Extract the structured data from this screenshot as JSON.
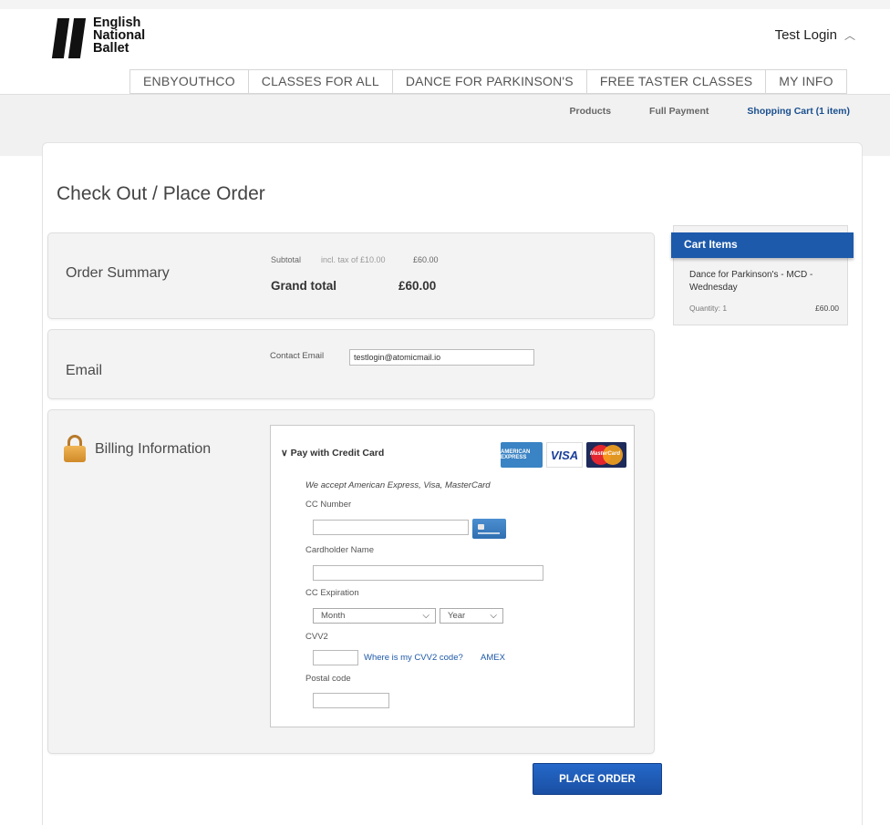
{
  "header": {
    "logo_line1": "English",
    "logo_line2": "National",
    "logo_line3": "Ballet",
    "login_label": "Test Login",
    "login_chevron": "︿"
  },
  "nav": {
    "items": [
      "ENBYOUTHCO",
      "CLASSES FOR ALL",
      "DANCE FOR PARKINSON'S",
      "FREE TASTER CLASSES",
      "MY INFO"
    ]
  },
  "subnav": {
    "products": "Products",
    "full_payment": "Full Payment",
    "shopping_cart": "Shopping Cart (1 item)"
  },
  "page_title": "Check Out / Place Order",
  "order_summary": {
    "title": "Order Summary",
    "subtotal_label": "Subtotal",
    "tax_note": "incl. tax of £10.00",
    "subtotal_value": "£60.00",
    "grand_total_label": "Grand total",
    "grand_total_value": "£60.00"
  },
  "email": {
    "title": "Email",
    "contact_label": "Contact Email",
    "contact_value": "testlogin@atomicmail.io"
  },
  "billing": {
    "title": "Billing Information",
    "pay_header": "∨ Pay with Credit Card",
    "amex_logo": "AMERICAN EXPRESS",
    "visa_logo": "VISA",
    "mc_logo": "MasterCard",
    "accept_text": "We accept American Express, Visa, MasterCard",
    "cc_number_label": "CC Number",
    "cardholder_label": "Cardholder Name",
    "expiration_label": "CC Expiration",
    "month_value": "Month",
    "year_value": "Year",
    "cvv_label": "CVV2",
    "cvv_link": "Where is my CVV2 code?",
    "amex_link": "AMEX",
    "postal_label": "Postal code"
  },
  "cart": {
    "title": "Cart Items",
    "item_name": "Dance for Parkinson's - MCD - Wednesday",
    "quantity": "Quantity: 1",
    "price": "£60.00"
  },
  "actions": {
    "place_order": "PLACE ORDER"
  },
  "colors": {
    "primary_blue": "#1d5aab",
    "link_blue": "#1d58a8",
    "panel_bg": "#f3f3f3"
  }
}
